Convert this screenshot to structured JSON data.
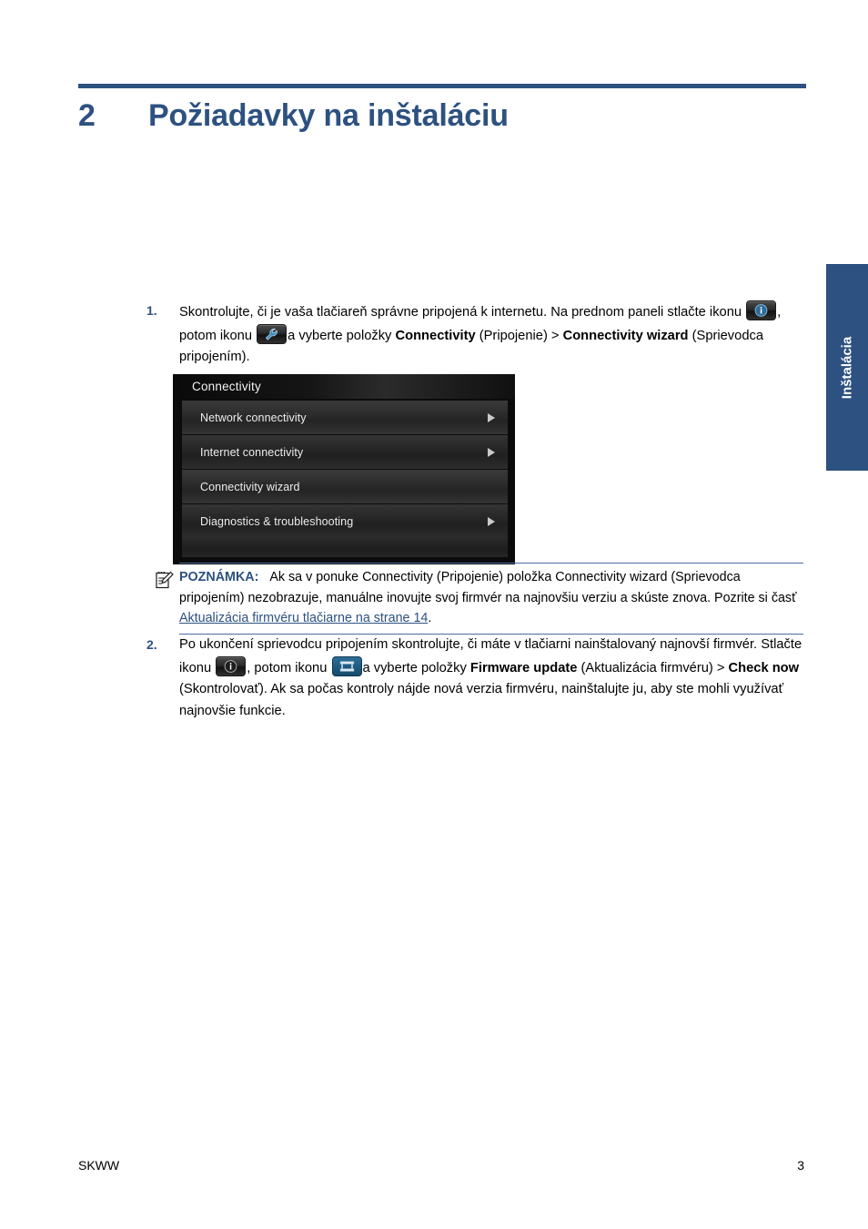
{
  "chapter": {
    "number": "2",
    "title": "Požiadavky na inštaláciu"
  },
  "side_tab": {
    "label": "Inštalácia"
  },
  "colors": {
    "accent_blue": "#2d5180",
    "link_blue": "#2d5180",
    "rule_blue": "#4a6fa0"
  },
  "steps": [
    {
      "marker": "1.",
      "text_1": "Skontrolujte, či je vaša tlačiareň správne pripojená k internetu. Na prednom paneli stlačte ikonu",
      "icon_1": "info-icon",
      "text_2": ", potom ikonu",
      "icon_2": "wrench-icon",
      "text_3": "a vyberte položky",
      "bold_1": "Connectivity",
      "text_4": "(Pripojenie) >",
      "bold_2": "Connectivity wizard",
      "text_5": "(Sprievodca pripojením)."
    },
    {
      "marker": "2.",
      "text_1": "Po ukončení sprievodcu pripojením skontrolujte, či máte v tlačiarni nainštalovaný najnovší firmvér. Stlačte ikonu",
      "icon_1": "info-icon",
      "text_2": ", potom ikonu",
      "icon_2": "printer-icon",
      "text_3": "a vyberte položky",
      "bold_1": "Firmware update",
      "text_4": "(Aktualizácia firmvéru) >",
      "bold_2": "Check now",
      "text_5": "(Skontrolovať). Ak sa počas kontroly nájde nová verzia firmvéru, nainštalujte ju, aby ste mohli využívať najnovšie funkcie."
    }
  ],
  "device_screenshot": {
    "title": "Connectivity",
    "rows": [
      {
        "label": "Network connectivity",
        "has_arrow": true
      },
      {
        "label": "Internet connectivity",
        "has_arrow": true
      },
      {
        "label": "Connectivity wizard",
        "has_arrow": false
      },
      {
        "label": "Diagnostics & troubleshooting",
        "has_arrow": true
      }
    ]
  },
  "note": {
    "icon": "note-pencil-icon",
    "label": "POZNÁMKA:",
    "text_1": "Ak sa v ponuke Connectivity (Pripojenie) položka Connectivity wizard (Sprievodca pripojením) nezobrazuje, manuálne inovujte svoj firmvér na najnovšiu verziu a skúste znova. Pozrite si časť",
    "link": "Aktualizácia firmvéru tlačiarne na strane 14",
    "text_2": "."
  },
  "footer": {
    "left": "SKWW",
    "right": "3"
  }
}
